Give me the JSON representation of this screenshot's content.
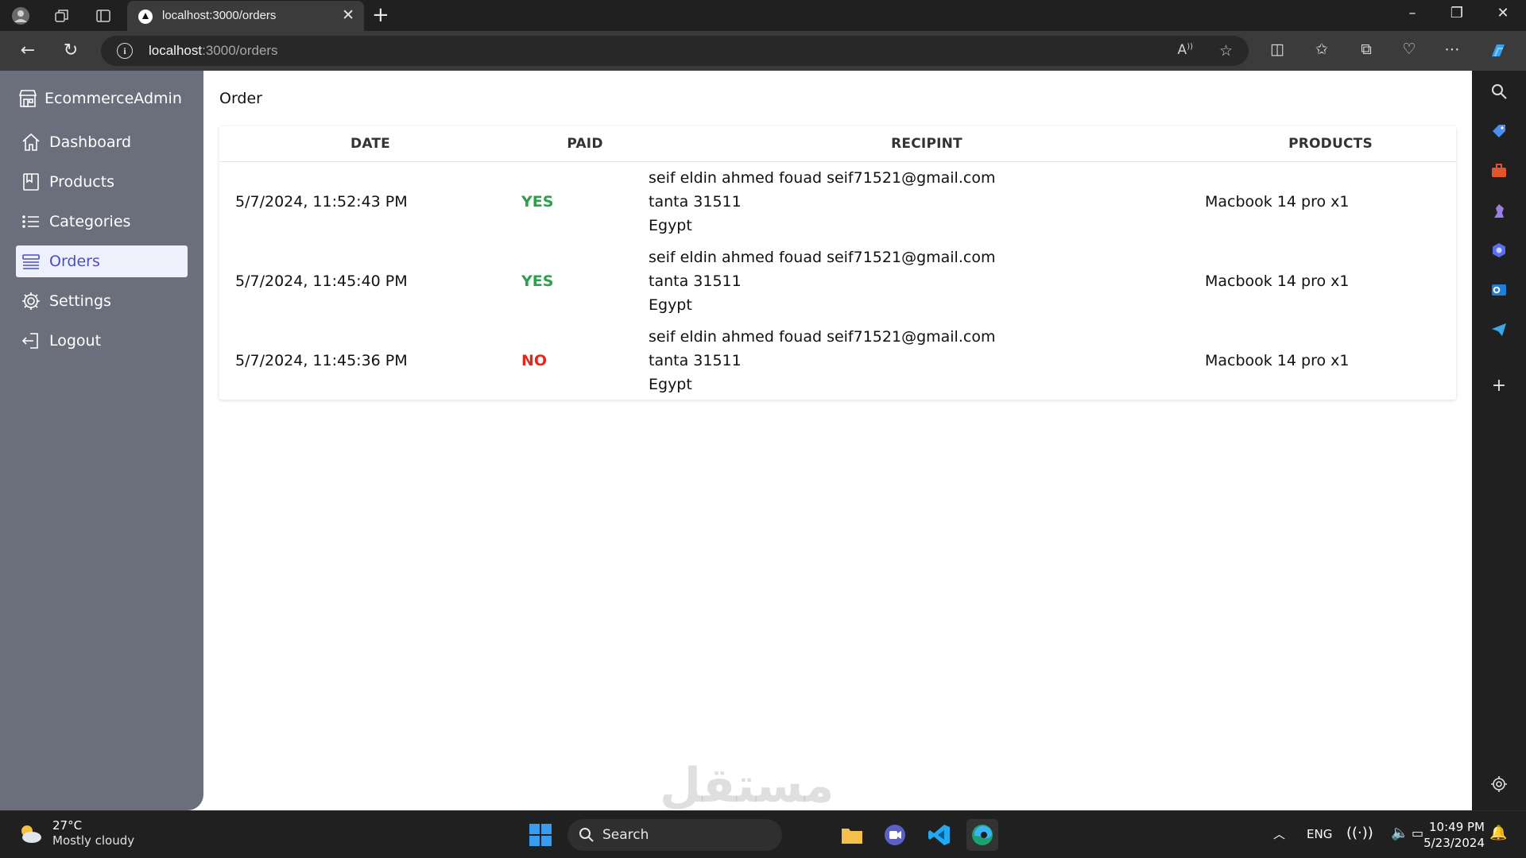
{
  "browser": {
    "tab_title": "localhost:3000/orders",
    "url_host": "localhost",
    "url_path": ":3000/orders"
  },
  "sidebar": {
    "brand": "EcommerceAdmin",
    "items": [
      {
        "label": "Dashboard",
        "icon": "home-icon"
      },
      {
        "label": "Products",
        "icon": "archive-icon"
      },
      {
        "label": "Categories",
        "icon": "list-icon"
      },
      {
        "label": "Orders",
        "icon": "queue-icon",
        "active": true
      },
      {
        "label": "Settings",
        "icon": "gear-icon"
      },
      {
        "label": "Logout",
        "icon": "logout-icon"
      }
    ]
  },
  "main": {
    "title": "Order",
    "columns": [
      "DATE",
      "PAID",
      "RECIPINT",
      "PRODUCTS"
    ],
    "orders": [
      {
        "date": "5/7/2024, 11:52:43 PM",
        "paid": "YES",
        "recipient_line1": "seif eldin ahmed fouad seif71521@gmail.com",
        "recipient_line2": "tanta 31511",
        "recipient_line3": "Egypt",
        "products": "Macbook 14 pro x1"
      },
      {
        "date": "5/7/2024, 11:45:40 PM",
        "paid": "YES",
        "recipient_line1": "seif eldin ahmed fouad seif71521@gmail.com",
        "recipient_line2": "tanta 31511",
        "recipient_line3": "Egypt",
        "products": "Macbook 14 pro x1"
      },
      {
        "date": "5/7/2024, 11:45:36 PM",
        "paid": "NO",
        "recipient_line1": "seif eldin ahmed fouad seif71521@gmail.com",
        "recipient_line2": "tanta 31511",
        "recipient_line3": "Egypt",
        "products": "Macbook 14 pro x1"
      }
    ]
  },
  "colors": {
    "sidebar_bg": "#6b6f7c",
    "active_text": "#4a4fc6",
    "paid_yes": "#2f9e4f",
    "paid_no": "#e02a20"
  },
  "taskbar": {
    "weather_temp": "27°C",
    "weather_desc": "Mostly cloudy",
    "search_label": "Search",
    "language": "ENG",
    "time": "10:49 PM",
    "date": "5/23/2024"
  }
}
